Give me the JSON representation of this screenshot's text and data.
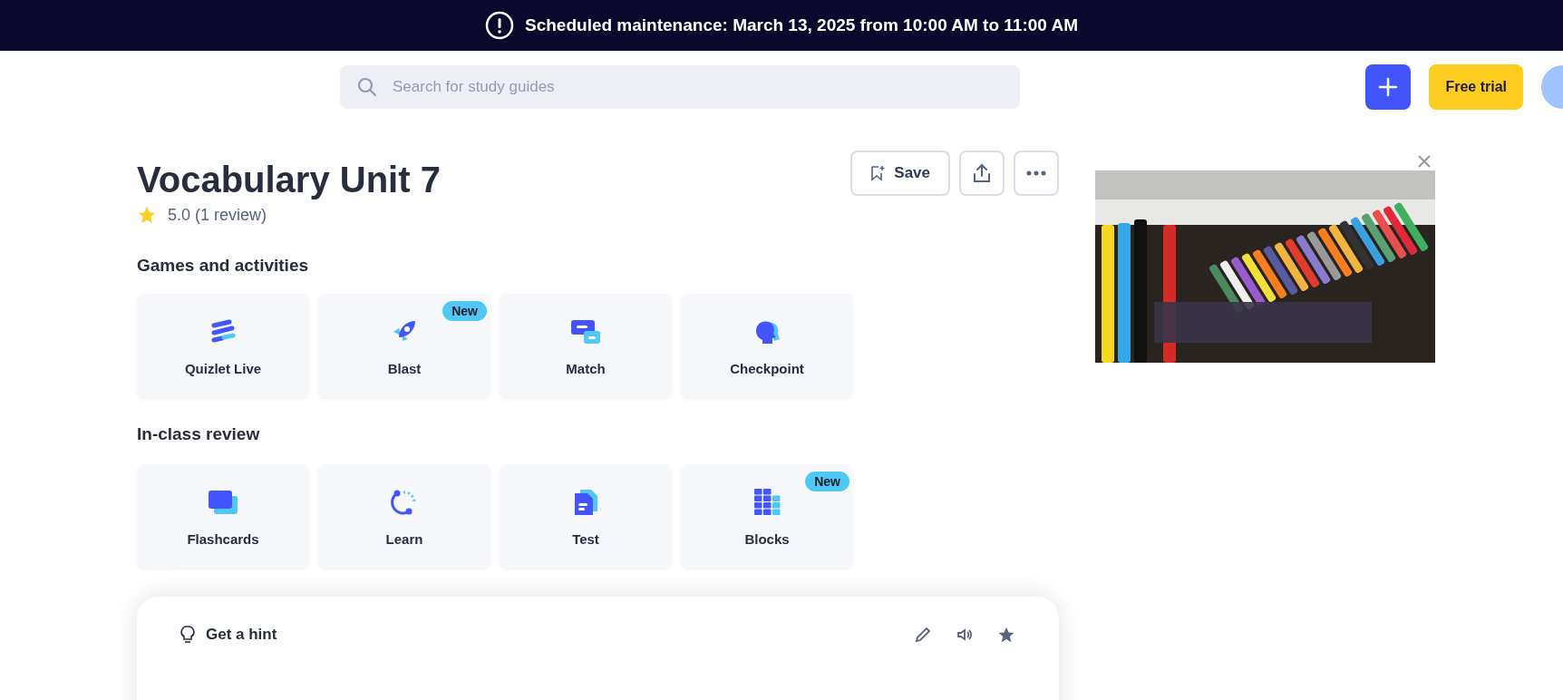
{
  "banner": {
    "text": "Scheduled maintenance: March 13, 2025 from 10:00 AM to 11:00 AM"
  },
  "header": {
    "search": {
      "placeholder": "Search for study guides"
    },
    "free_trial": "Free trial"
  },
  "set": {
    "title": "Vocabulary Unit 7",
    "rating": "5.0 (1 review)",
    "save": "Save"
  },
  "sections": [
    {
      "heading": "Games and activities",
      "items": [
        {
          "label": "Quizlet Live"
        },
        {
          "label": "Blast",
          "badge": "New"
        },
        {
          "label": "Match"
        },
        {
          "label": "Checkpoint"
        }
      ]
    },
    {
      "heading": "In-class review",
      "items": [
        {
          "label": "Flashcards"
        },
        {
          "label": "Learn"
        },
        {
          "label": "Test"
        },
        {
          "label": "Blocks",
          "badge": "New"
        }
      ]
    }
  ],
  "card": {
    "hint": "Get a hint"
  }
}
